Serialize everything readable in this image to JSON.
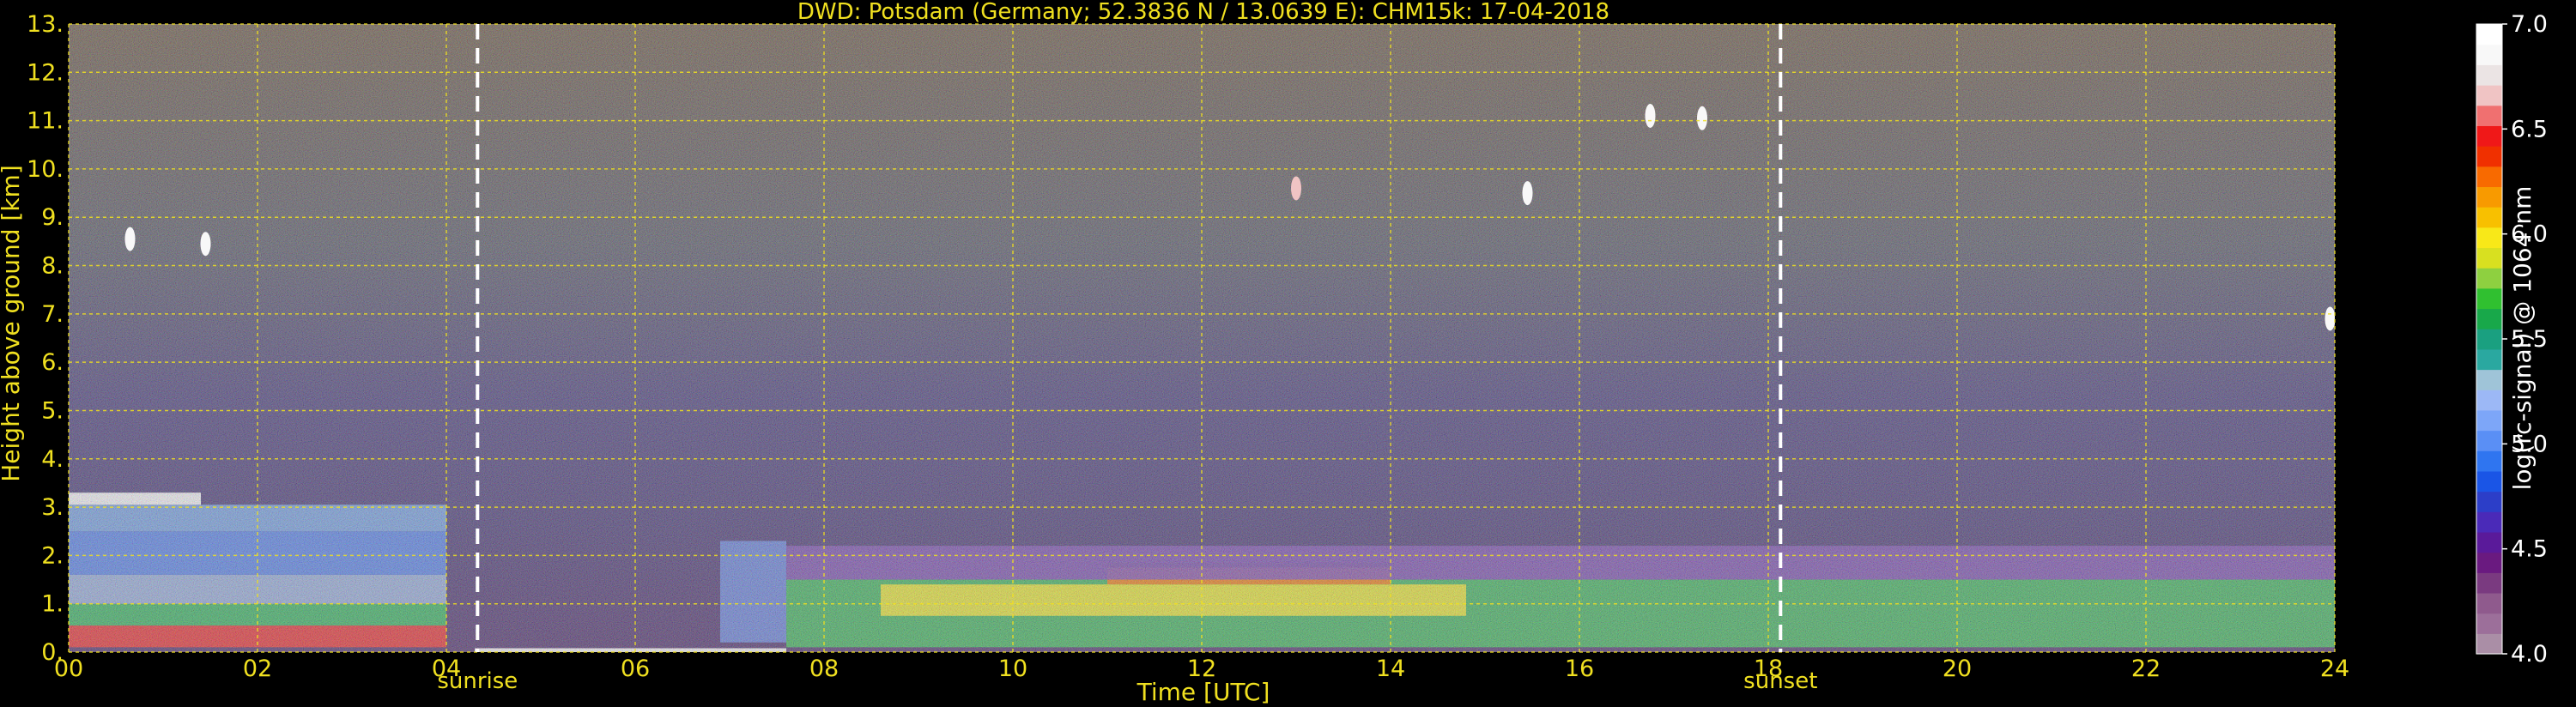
{
  "chart_data": {
    "type": "heatmap",
    "title": "DWD: Potsdam (Germany; 52.3836 N / 13.0639 E):    CHM15k: 17-04-2018",
    "xlabel": "Time [UTC]",
    "ylabel": "Height above ground [km]",
    "xlim": [
      0,
      24
    ],
    "ylim": [
      0,
      13
    ],
    "x_ticks": [
      "00",
      "02",
      "04",
      "06",
      "08",
      "10",
      "12",
      "14",
      "16",
      "18",
      "20",
      "22",
      "24"
    ],
    "y_ticks": [
      "0.",
      "1.",
      "2.",
      "3.",
      "4.",
      "5.",
      "6.",
      "7.",
      "8.",
      "9.",
      "10.",
      "11.",
      "12.",
      "13."
    ],
    "grid": true,
    "markers": [
      {
        "label": "sunrise",
        "x": 4.33
      },
      {
        "label": "sunset",
        "x": 18.13
      }
    ],
    "colorbar": {
      "label": "log(rc-signal) @ 1064 nm",
      "range": [
        4.0,
        7.0
      ],
      "ticks": [
        "4.0",
        "4.5",
        "5.0",
        "5.5",
        "6.0",
        "6.5",
        "7.0"
      ],
      "colors": [
        "#aa8ea6",
        "#9c6f9a",
        "#8f5a8d",
        "#7a3a80",
        "#6a1a80",
        "#5a1a9a",
        "#4a2ab8",
        "#2c3ec8",
        "#1a55e6",
        "#2f75f0",
        "#5a8ff5",
        "#7da6f8",
        "#9cb8f6",
        "#9fc4d8",
        "#2aa8a0",
        "#1aa080",
        "#18a84a",
        "#30c030",
        "#8ed040",
        "#d8e020",
        "#f8e818",
        "#f8c000",
        "#f89a00",
        "#f86a00",
        "#f03000",
        "#f01818",
        "#f07070",
        "#f0c4c4",
        "#ebe4e4",
        "#f8f8f8",
        "#ffffff"
      ]
    },
    "layers": [
      {
        "t0": 0,
        "t1": 4.0,
        "h0": 0.1,
        "h1": 0.55,
        "color": "#e82020"
      },
      {
        "t0": 0,
        "t1": 4.0,
        "h0": 0.55,
        "h1": 1.0,
        "color": "#24b050"
      },
      {
        "t0": 0,
        "t1": 4.0,
        "h0": 1.0,
        "h1": 1.6,
        "color": "#8ea8d8"
      },
      {
        "t0": 0,
        "t1": 4.0,
        "h0": 1.6,
        "h1": 2.5,
        "color": "#4a7ae8"
      },
      {
        "t0": 0,
        "t1": 4.0,
        "h0": 2.5,
        "h1": 3.05,
        "color": "#6a9ae0"
      },
      {
        "t0": 0,
        "t1": 1.4,
        "h0": 3.05,
        "h1": 3.3,
        "color": "#f8f8f8"
      },
      {
        "t0": 6.9,
        "t1": 7.6,
        "h0": 0.2,
        "h1": 2.3,
        "color": "#5a78d8"
      },
      {
        "t0": 7.6,
        "t1": 24,
        "h0": 0.1,
        "h1": 1.5,
        "color": "#2cb04c"
      },
      {
        "t0": 8.6,
        "t1": 14.8,
        "h0": 0.75,
        "h1": 1.4,
        "color": "#e8dc20"
      },
      {
        "t0": 11.0,
        "t1": 14.0,
        "h0": 1.4,
        "h1": 1.75,
        "color": "#f06a00"
      },
      {
        "t0": 11.0,
        "t1": 14.0,
        "h0": 1.75,
        "h1": 1.85,
        "color": "#101010"
      },
      {
        "t0": 7.6,
        "t1": 24,
        "h0": 1.5,
        "h1": 2.2,
        "color": "#7040a8"
      },
      {
        "t0": 4.3,
        "t1": 7.6,
        "h0": 0.0,
        "h1": 0.08,
        "color": "#f8f8f8"
      }
    ],
    "clouds": [
      {
        "t": 0.65,
        "h": 8.55,
        "color": "#f8f8f8"
      },
      {
        "t": 1.45,
        "h": 8.45,
        "color": "#f8f8f8"
      },
      {
        "t": 13.0,
        "h": 9.6,
        "color": "#f0c4c4"
      },
      {
        "t": 15.45,
        "h": 9.5,
        "color": "#f8f8f8"
      },
      {
        "t": 16.75,
        "h": 11.1,
        "color": "#f8f8f8"
      },
      {
        "t": 17.3,
        "h": 11.05,
        "color": "#f8f8f8"
      },
      {
        "t": 23.95,
        "h": 6.9,
        "color": "#f8f8f8"
      }
    ]
  },
  "colors": {
    "text": "#f0e020",
    "grid": "#f0e020",
    "marker": "#ffffff",
    "cbar_text": "#ffffff"
  }
}
